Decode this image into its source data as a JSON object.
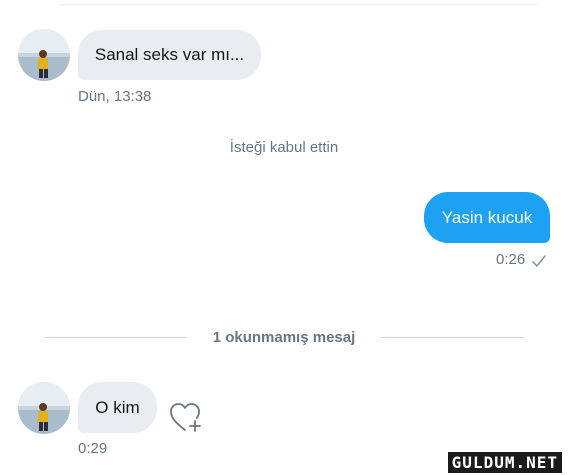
{
  "thread": {
    "messages": [
      {
        "direction": "incoming",
        "text": "Sanal seks var mı...",
        "time": "Dün, 13:38",
        "avatar_icon": "user-avatar-photo"
      },
      {
        "direction": "outgoing",
        "text": "Yasin kucuk",
        "time": "0:26",
        "status_icon": "sent-check-icon"
      },
      {
        "direction": "incoming",
        "text": "O kim",
        "time": "0:29",
        "avatar_icon": "user-avatar-photo",
        "reaction_icon": "add-reaction-heart-icon"
      }
    ],
    "system_message": "İsteği kabul ettin",
    "unread_divider": "1 okunmamış mesaj"
  },
  "watermark": "GULDUM.NET",
  "colors": {
    "incoming_bubble": "#e9edf1",
    "outgoing_bubble": "#1da1f2",
    "meta_text": "#657786",
    "divider": "#ccd6dd"
  }
}
